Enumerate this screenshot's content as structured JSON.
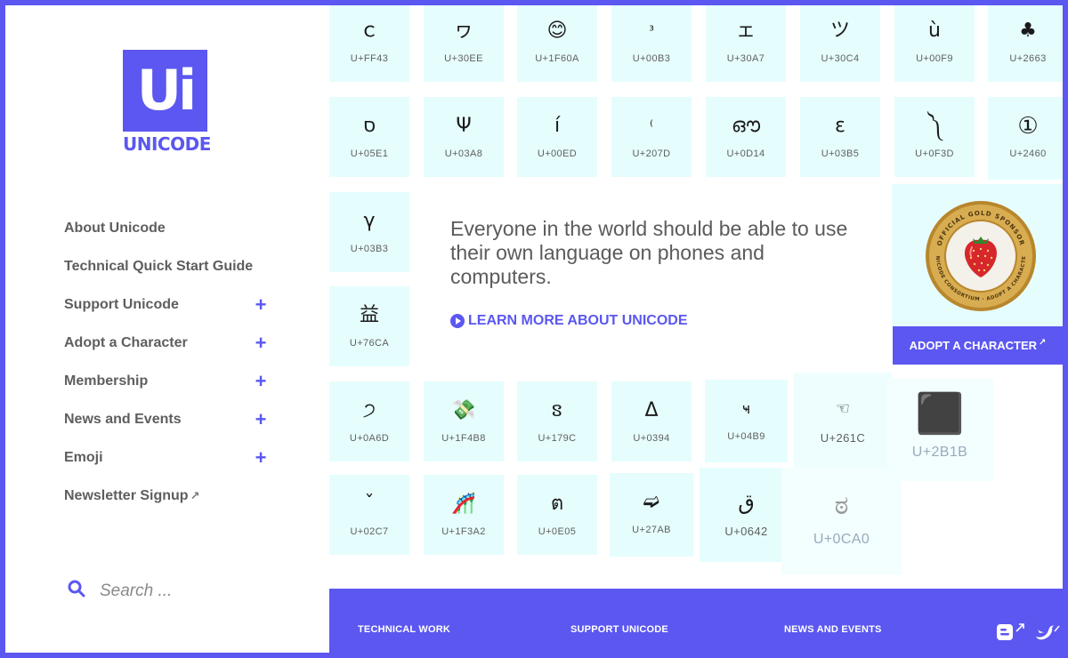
{
  "logo": {
    "mark": "Ui",
    "wordmark": "UNICODE"
  },
  "nav": [
    {
      "label": "About Unicode",
      "expandable": false
    },
    {
      "label": "Technical Quick Start Guide",
      "expandable": false
    },
    {
      "label": "Support Unicode",
      "expandable": true
    },
    {
      "label": "Adopt a Character",
      "expandable": true
    },
    {
      "label": "Membership",
      "expandable": true
    },
    {
      "label": "News and Events",
      "expandable": true
    },
    {
      "label": "Emoji",
      "expandable": true
    },
    {
      "label": "Newsletter Signup",
      "expandable": false,
      "external": true
    }
  ],
  "nav_expand_glyph": "+",
  "external_glyph": "↗",
  "search": {
    "placeholder": "Search ...",
    "value": ""
  },
  "tiles": [
    {
      "ch": "ｃ",
      "code": "U+FF43"
    },
    {
      "ch": "ヮ",
      "code": "U+30EE"
    },
    {
      "ch": "😊",
      "code": "U+1F60A"
    },
    {
      "ch": "³",
      "code": "U+00B3"
    },
    {
      "ch": "ェ",
      "code": "U+30A7"
    },
    {
      "ch": "ツ",
      "code": "U+30C4"
    },
    {
      "ch": "ù",
      "code": "U+00F9"
    },
    {
      "ch": "♣",
      "code": "U+2663"
    },
    {
      "ch": "ס",
      "code": "U+05E1"
    },
    {
      "ch": "Ψ",
      "code": "U+03A8"
    },
    {
      "ch": "í",
      "code": "U+00ED"
    },
    {
      "ch": "⁽",
      "code": "U+207D"
    },
    {
      "ch": "ഔ",
      "code": "U+0D14"
    },
    {
      "ch": "ε",
      "code": "U+03B5"
    },
    {
      "ch": "༽",
      "code": "U+0F3D"
    },
    {
      "ch": "①",
      "code": "U+2460"
    },
    {
      "ch": "γ",
      "code": "U+03B3"
    },
    {
      "ch": "益",
      "code": "U+76CA"
    },
    {
      "ch": "੭",
      "code": "U+0A6D"
    },
    {
      "ch": "💸",
      "code": "U+1F4B8"
    },
    {
      "ch": "ៜ",
      "code": "U+179C"
    },
    {
      "ch": "Δ",
      "code": "U+0394"
    },
    {
      "ch": "ҹ",
      "code": "U+04B9"
    },
    {
      "ch": "☜",
      "code": "U+261C"
    },
    {
      "ch": "⬛",
      "code": "U+2B1B"
    },
    {
      "ch": "ˇ",
      "code": "U+02C7"
    },
    {
      "ch": "🎢",
      "code": "U+1F3A2"
    },
    {
      "ch": "ต",
      "code": "U+0E05"
    },
    {
      "ch": "➫",
      "code": "U+27AB"
    },
    {
      "ch": "ق",
      "code": "U+0642"
    },
    {
      "ch": "ಠ",
      "code": "U+0CA0"
    }
  ],
  "hero": {
    "text": "Everyone in the world should be able to use their own language on phones and computers.",
    "link_label": "LEARN MORE ABOUT UNICODE"
  },
  "badge": {
    "top_text": "OFFICIAL GOLD SPONSOR",
    "bottom_text": "UNICODE CONSORTIUM · ADOPT A CHARACTER",
    "button_label": "ADOPT A CHARACTER"
  },
  "footer": {
    "links": [
      "TECHNICAL WORK",
      "SUPPORT UNICODE",
      "NEWS AND EVENTS"
    ]
  },
  "colors": {
    "brand": "#5b57f0",
    "tile": "#e6fdfd",
    "text": "#5e5e5e",
    "gold": "#c99a3b"
  }
}
